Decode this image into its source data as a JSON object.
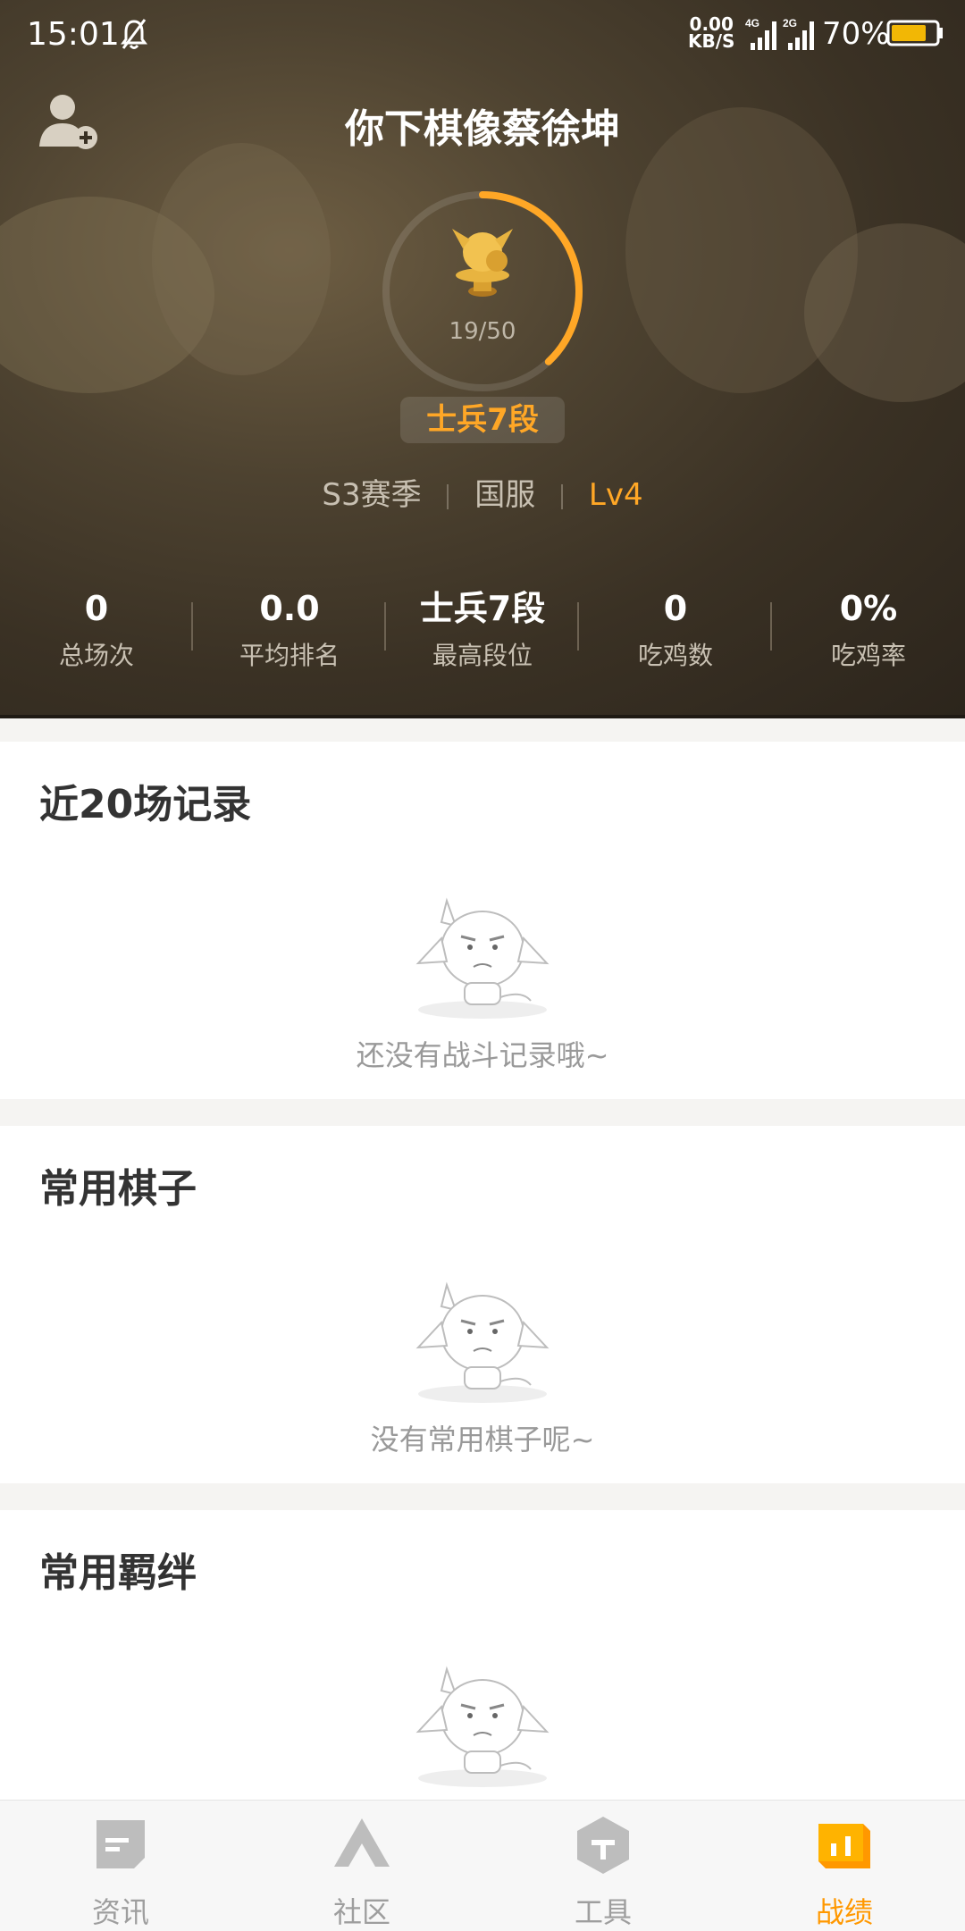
{
  "status": {
    "time": "15:01",
    "net_speed": "0.00",
    "net_unit": "KB/S",
    "sig1": "4G",
    "sig2": "2G",
    "battery": "70%"
  },
  "profile": {
    "name": "你下棋像蔡徐坤",
    "progress": "19/50",
    "progress_fraction": 0.38,
    "rank": "士兵7段",
    "season": "S3赛季",
    "server": "国服",
    "level": "Lv4"
  },
  "stats": [
    {
      "value": "0",
      "label": "总场次"
    },
    {
      "value": "0.0",
      "label": "平均排名"
    },
    {
      "value": "士兵7段",
      "label": "最高段位"
    },
    {
      "value": "0",
      "label": "吃鸡数"
    },
    {
      "value": "0%",
      "label": "吃鸡率"
    }
  ],
  "sections": [
    {
      "title": "近20场记录",
      "empty": "还没有战斗记录哦~"
    },
    {
      "title": "常用棋子",
      "empty": "没有常用棋子呢~"
    },
    {
      "title": "常用羁绊",
      "empty": ""
    }
  ],
  "tabs": [
    {
      "label": "资讯",
      "icon": "news-icon"
    },
    {
      "label": "社区",
      "icon": "community-icon"
    },
    {
      "label": "工具",
      "icon": "tools-icon"
    },
    {
      "label": "战绩",
      "icon": "record-icon"
    }
  ],
  "colors": {
    "accent": "#ff9800",
    "rank": "#ffa726",
    "header_bg": "#3a3124"
  }
}
